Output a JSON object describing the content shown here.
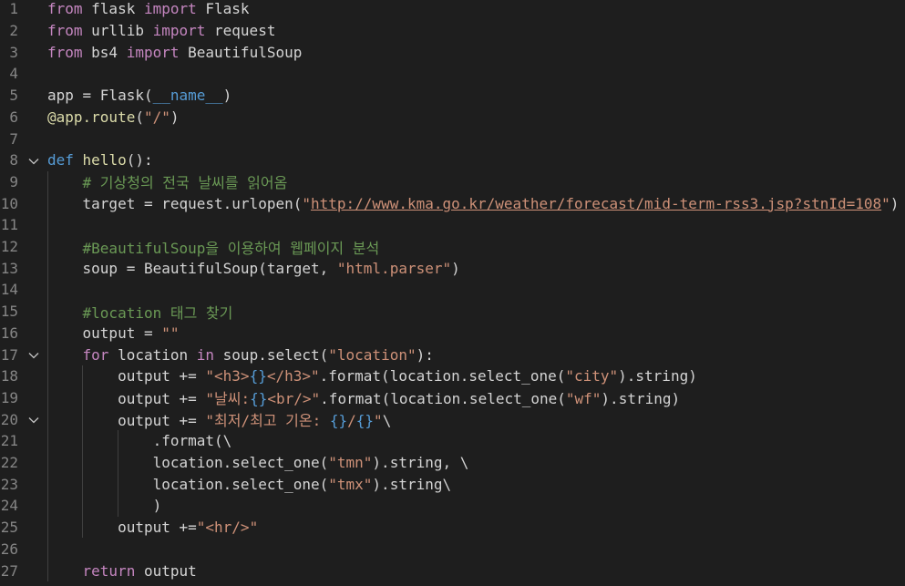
{
  "editor": {
    "language": "python",
    "colors": {
      "background": "#1e1e1e",
      "keyword": "#c586c0",
      "def_keyword": "#569cd6",
      "function": "#dcdcaa",
      "string": "#ce9178",
      "comment": "#6a9955",
      "line_number": "#858585"
    },
    "lines": [
      {
        "n": "1",
        "tokens": [
          [
            "kw",
            "from"
          ],
          [
            "txt",
            " flask "
          ],
          [
            "kw",
            "import"
          ],
          [
            "txt",
            " Flask"
          ]
        ]
      },
      {
        "n": "2",
        "tokens": [
          [
            "kw",
            "from"
          ],
          [
            "txt",
            " urllib "
          ],
          [
            "kw",
            "import"
          ],
          [
            "txt",
            " request"
          ]
        ]
      },
      {
        "n": "3",
        "tokens": [
          [
            "kw",
            "from"
          ],
          [
            "txt",
            " bs4 "
          ],
          [
            "kw",
            "import"
          ],
          [
            "txt",
            " BeautifulSoup"
          ]
        ]
      },
      {
        "n": "4",
        "tokens": []
      },
      {
        "n": "5",
        "tokens": [
          [
            "txt",
            "app = Flask("
          ],
          [
            "kwb",
            "__name__"
          ],
          [
            "txt",
            ")"
          ]
        ]
      },
      {
        "n": "6",
        "tokens": [
          [
            "fn",
            "@app.route"
          ],
          [
            "txt",
            "("
          ],
          [
            "str",
            "\"/\""
          ],
          [
            "txt",
            ")"
          ]
        ]
      },
      {
        "n": "7",
        "tokens": []
      },
      {
        "n": "8",
        "fold": true,
        "tokens": [
          [
            "kwb",
            "def"
          ],
          [
            "txt",
            " "
          ],
          [
            "fn",
            "hello"
          ],
          [
            "txt",
            "():"
          ]
        ]
      },
      {
        "n": "9",
        "tokens": [
          [
            "txt",
            "    "
          ],
          [
            "cmt",
            "# 기상청의 전국 날씨를 읽어옴"
          ]
        ]
      },
      {
        "n": "10",
        "tokens": [
          [
            "txt",
            "    target = request.urlopen("
          ],
          [
            "str",
            "\""
          ],
          [
            "link",
            "http://www.kma.go.kr/weather/forecast/mid-term-rss3.jsp?stnId=108"
          ],
          [
            "str",
            "\""
          ],
          [
            "txt",
            ")"
          ]
        ]
      },
      {
        "n": "11",
        "tokens": []
      },
      {
        "n": "12",
        "tokens": [
          [
            "txt",
            "    "
          ],
          [
            "cmt",
            "#BeautifulSoup을 이용하여 웹페이지 분석"
          ]
        ]
      },
      {
        "n": "13",
        "tokens": [
          [
            "txt",
            "    soup = BeautifulSoup(target, "
          ],
          [
            "str",
            "\"html.parser\""
          ],
          [
            "txt",
            ")"
          ]
        ]
      },
      {
        "n": "14",
        "tokens": []
      },
      {
        "n": "15",
        "tokens": [
          [
            "txt",
            "    "
          ],
          [
            "cmt",
            "#location 태그 찾기"
          ]
        ]
      },
      {
        "n": "16",
        "tokens": [
          [
            "txt",
            "    output = "
          ],
          [
            "str",
            "\"\""
          ]
        ]
      },
      {
        "n": "17",
        "fold": true,
        "tokens": [
          [
            "txt",
            "    "
          ],
          [
            "kw",
            "for"
          ],
          [
            "txt",
            " location "
          ],
          [
            "kw",
            "in"
          ],
          [
            "txt",
            " soup.select("
          ],
          [
            "str",
            "\"location\""
          ],
          [
            "txt",
            "):"
          ]
        ]
      },
      {
        "n": "18",
        "tokens": [
          [
            "txt",
            "        output += "
          ],
          [
            "str",
            "\"<h3>"
          ],
          [
            "brace",
            "{}"
          ],
          [
            "str",
            "</h3>\""
          ],
          [
            "txt",
            ".format(location.select_one("
          ],
          [
            "str",
            "\"city\""
          ],
          [
            "txt",
            ").string)"
          ]
        ]
      },
      {
        "n": "19",
        "tokens": [
          [
            "txt",
            "        output += "
          ],
          [
            "str",
            "\"날씨:"
          ],
          [
            "brace",
            "{}"
          ],
          [
            "str",
            "<br/>\""
          ],
          [
            "txt",
            ".format(location.select_one("
          ],
          [
            "str",
            "\"wf\""
          ],
          [
            "txt",
            ").string)"
          ]
        ]
      },
      {
        "n": "20",
        "fold": true,
        "tokens": [
          [
            "txt",
            "        output += "
          ],
          [
            "str",
            "\"최저/최고 기온: "
          ],
          [
            "brace",
            "{}"
          ],
          [
            "str",
            "/"
          ],
          [
            "brace",
            "{}"
          ],
          [
            "str",
            "\""
          ],
          [
            "txt",
            "\\"
          ]
        ]
      },
      {
        "n": "21",
        "tokens": [
          [
            "txt",
            "            .format(\\"
          ]
        ]
      },
      {
        "n": "22",
        "tokens": [
          [
            "txt",
            "            location.select_one("
          ],
          [
            "str",
            "\"tmn\""
          ],
          [
            "txt",
            ").string, \\"
          ]
        ]
      },
      {
        "n": "23",
        "tokens": [
          [
            "txt",
            "            location.select_one("
          ],
          [
            "str",
            "\"tmx\""
          ],
          [
            "txt",
            ").string\\"
          ]
        ]
      },
      {
        "n": "24",
        "tokens": [
          [
            "txt",
            "            )"
          ]
        ]
      },
      {
        "n": "25",
        "tokens": [
          [
            "txt",
            "        output +="
          ],
          [
            "str",
            "\"<hr/>\""
          ]
        ]
      },
      {
        "n": "26",
        "tokens": []
      },
      {
        "n": "27",
        "tokens": [
          [
            "txt",
            "    "
          ],
          [
            "kw",
            "return"
          ],
          [
            "txt",
            " output"
          ]
        ]
      }
    ]
  }
}
